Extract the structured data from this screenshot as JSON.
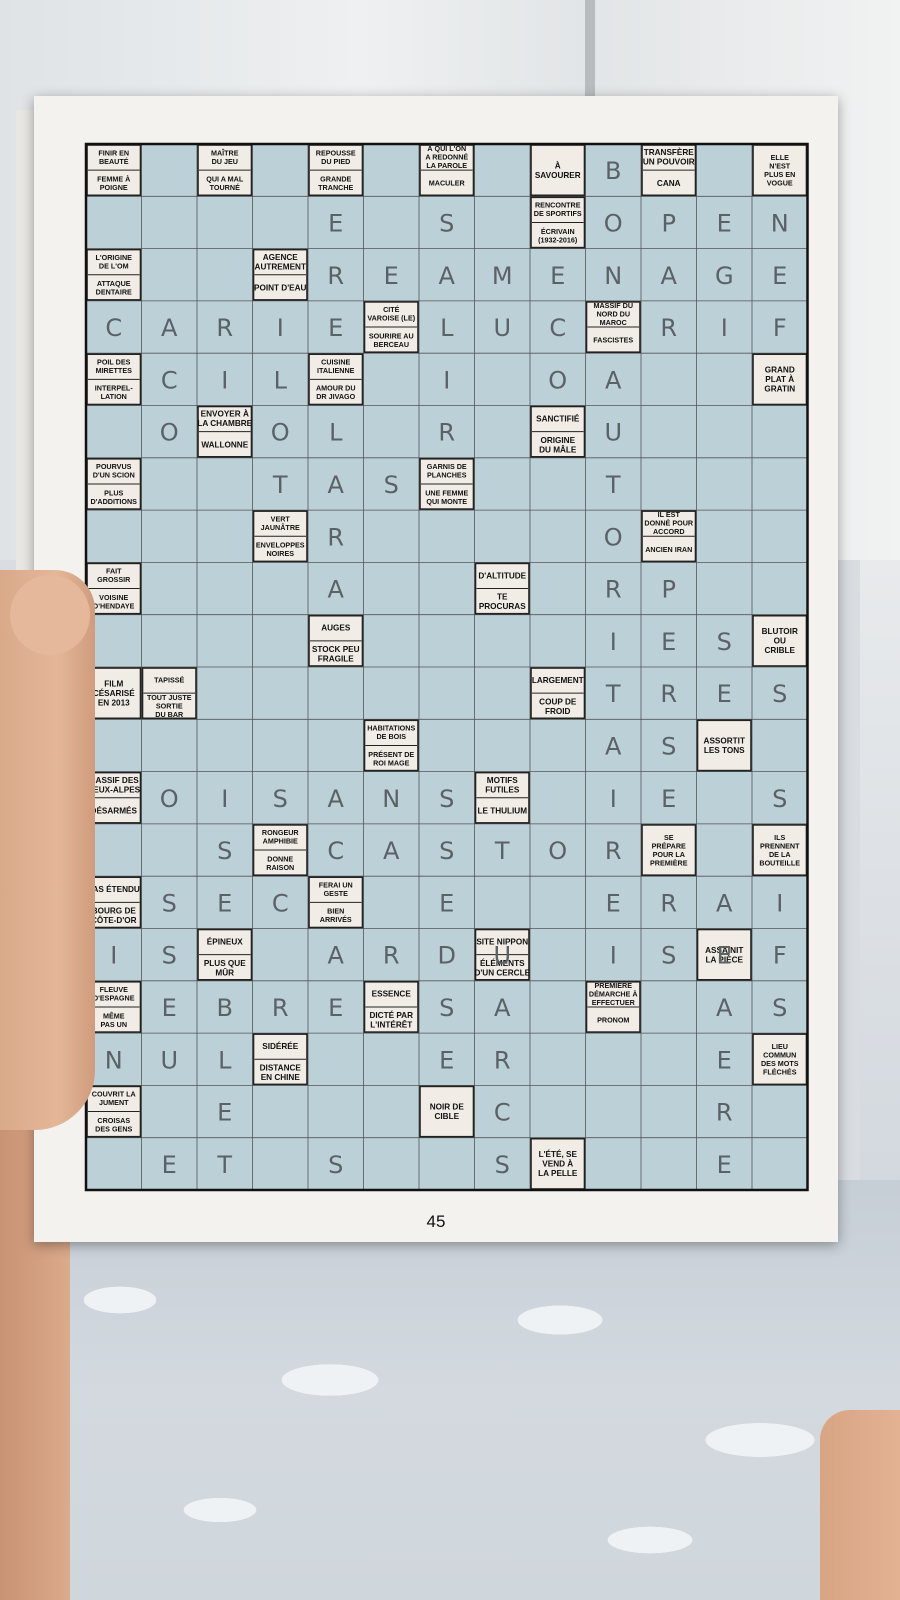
{
  "page_number": "45",
  "colors": {
    "cell": "#bcd0d8",
    "clue": "#f1ede6",
    "ink": "#111111",
    "pencil": "#5c6166"
  },
  "clues": [
    {
      "c": 0,
      "r": 0,
      "lines": [
        [
          "FINIR EN",
          "BEAUTÉ"
        ],
        [
          "FEMME À",
          "POIGNE"
        ]
      ]
    },
    {
      "c": 2,
      "r": 0,
      "lines": [
        [
          "MAÎTRE",
          "DU JEU"
        ],
        [
          "QUI A MAL",
          "TOURNÉ"
        ]
      ]
    },
    {
      "c": 4,
      "r": 0,
      "lines": [
        [
          "REPOUSSE",
          "DU PIED"
        ],
        [
          "GRANDE",
          "TRANCHE"
        ]
      ]
    },
    {
      "c": 6,
      "r": 0,
      "lines": [
        [
          "À QUI L'ON",
          "A REDONNÉ",
          "LA PAROLE"
        ],
        [
          "MACULER"
        ]
      ]
    },
    {
      "c": 8,
      "r": 0,
      "lines": [
        [
          "À",
          "SAVOURER"
        ]
      ]
    },
    {
      "c": 10,
      "r": 0,
      "lines": [
        [
          "TRANSFÈRE",
          "UN POUVOIR"
        ],
        [
          "CANA"
        ]
      ]
    },
    {
      "c": 12,
      "r": 0,
      "lines": [
        [
          "ELLE",
          "N'EST",
          "PLUS EN",
          "VOGUE"
        ]
      ]
    },
    {
      "c": 8,
      "r": 1,
      "lines": [
        [
          "RENCONTRE",
          "DE SPORTIFS"
        ],
        [
          "ÉCRIVAIN",
          "(1932-2016)"
        ]
      ]
    },
    {
      "c": 0,
      "r": 2,
      "lines": [
        [
          "L'ORIGINE",
          "DE L'OM"
        ],
        [
          "ATTAQUE",
          "DENTAIRE"
        ]
      ]
    },
    {
      "c": 3,
      "r": 2,
      "lines": [
        [
          "AGENCE",
          "AUTREMENT"
        ],
        [
          "POINT D'EAU"
        ]
      ]
    },
    {
      "c": 5,
      "r": 3,
      "lines": [
        [
          "CITÉ",
          "VAROISE (LE)"
        ],
        [
          "SOURIRE AU",
          "BERCEAU"
        ]
      ]
    },
    {
      "c": 9,
      "r": 3,
      "lines": [
        [
          "MASSIF DU",
          "NORD DU",
          "MAROC"
        ],
        [
          "FASCISTES"
        ]
      ]
    },
    {
      "c": 0,
      "r": 4,
      "lines": [
        [
          "POIL DES",
          "MIRETTES"
        ],
        [
          "INTERPEL-",
          "LATION"
        ]
      ]
    },
    {
      "c": 4,
      "r": 4,
      "lines": [
        [
          "CUISINE",
          "ITALIENNE"
        ],
        [
          "AMOUR DU",
          "DR JIVAGO"
        ]
      ]
    },
    {
      "c": 12,
      "r": 4,
      "lines": [
        [
          "GRAND",
          "PLAT À",
          "GRATIN"
        ]
      ]
    },
    {
      "c": 2,
      "r": 5,
      "lines": [
        [
          "ENVOYER À",
          "LA CHAMBRE"
        ],
        [
          "WALLONNE"
        ]
      ]
    },
    {
      "c": 8,
      "r": 5,
      "lines": [
        [
          "SANCTIFIÉ"
        ],
        [
          "ORIGINE",
          "DU MÂLE"
        ]
      ]
    },
    {
      "c": 0,
      "r": 6,
      "lines": [
        [
          "POURVUS",
          "D'UN SCION"
        ],
        [
          "PLUS",
          "D'ADDITIONS"
        ]
      ]
    },
    {
      "c": 6,
      "r": 6,
      "lines": [
        [
          "GARNIS DE",
          "PLANCHES"
        ],
        [
          "UNE FEMME",
          "QUI MONTE"
        ]
      ]
    },
    {
      "c": 3,
      "r": 7,
      "lines": [
        [
          "VERT",
          "JAUNÂTRE"
        ],
        [
          "ENVELOPPES",
          "NOIRES"
        ]
      ]
    },
    {
      "c": 10,
      "r": 7,
      "lines": [
        [
          "IL EST",
          "DONNÉ POUR",
          "ACCORD"
        ],
        [
          "ANCIEN IRAN"
        ]
      ]
    },
    {
      "c": 0,
      "r": 8,
      "lines": [
        [
          "FAIT",
          "GROSSIR"
        ],
        [
          "VOISINE",
          "D'HENDAYE"
        ]
      ]
    },
    {
      "c": 7,
      "r": 8,
      "lines": [
        [
          "D'ALTITUDE"
        ],
        [
          "TE",
          "PROCURAS"
        ]
      ]
    },
    {
      "c": 4,
      "r": 9,
      "lines": [
        [
          "AUGES"
        ],
        [
          "STOCK PEU",
          "FRAGILE"
        ]
      ]
    },
    {
      "c": 12,
      "r": 9,
      "lines": [
        [
          "BLUTOIR",
          "OU",
          "CRIBLE"
        ]
      ]
    },
    {
      "c": 0,
      "r": 10,
      "lines": [
        [
          "FILM",
          "CÉSARISÉ",
          "EN 2013"
        ]
      ]
    },
    {
      "c": 1,
      "r": 10,
      "lines": [
        [
          "TAPISSÉ"
        ],
        [
          "TOUT JUSTE",
          "SORTIE",
          "DU BAR"
        ]
      ]
    },
    {
      "c": 8,
      "r": 10,
      "lines": [
        [
          "LARGEMENT"
        ],
        [
          "COUP DE",
          "FROID"
        ]
      ]
    },
    {
      "c": 5,
      "r": 11,
      "lines": [
        [
          "HABITATIONS",
          "DE BOIS"
        ],
        [
          "PRÉSENT DE",
          "ROI MAGE"
        ]
      ]
    },
    {
      "c": 11,
      "r": 11,
      "lines": [
        [
          "ASSORTIT",
          "LES TONS"
        ]
      ]
    },
    {
      "c": 0,
      "r": 12,
      "lines": [
        [
          "MASSIF DES",
          "DEUX-ALPES"
        ],
        [
          "DÉSARMÉS"
        ]
      ]
    },
    {
      "c": 7,
      "r": 12,
      "lines": [
        [
          "MOTIFS",
          "FUTILES"
        ],
        [
          "LE THULIUM"
        ]
      ]
    },
    {
      "c": 3,
      "r": 13,
      "lines": [
        [
          "RONGEUR",
          "AMPHIBIE"
        ],
        [
          "DONNE",
          "RAISON"
        ]
      ]
    },
    {
      "c": 10,
      "r": 13,
      "lines": [
        [
          "SE",
          "PRÉPARE",
          "POUR LA",
          "PREMIÈRE"
        ]
      ]
    },
    {
      "c": 12,
      "r": 13,
      "lines": [
        [
          "ILS",
          "PRENNENT",
          "DE LA",
          "BOUTEILLE"
        ]
      ]
    },
    {
      "c": 0,
      "r": 14,
      "lines": [
        [
          "PAS ÉTENDU"
        ],
        [
          "BOURG DE",
          "CÔTE-D'OR"
        ]
      ]
    },
    {
      "c": 4,
      "r": 14,
      "lines": [
        [
          "FERAI UN",
          "GESTE"
        ],
        [
          "BIEN",
          "ARRIVÉS"
        ]
      ]
    },
    {
      "c": 2,
      "r": 15,
      "lines": [
        [
          "ÉPINEUX"
        ],
        [
          "PLUS QUE",
          "MÛR"
        ]
      ]
    },
    {
      "c": 7,
      "r": 15,
      "lines": [
        [
          "SITE NIPPON"
        ],
        [
          "ÉLÉMENTS",
          "D'UN CERCLE"
        ]
      ]
    },
    {
      "c": 11,
      "r": 15,
      "lines": [
        [
          "ASSAINIT",
          "LA PIÈCE"
        ]
      ]
    },
    {
      "c": 0,
      "r": 16,
      "lines": [
        [
          "FLEUVE",
          "D'ESPAGNE"
        ],
        [
          "MÊME",
          "PAS UN"
        ]
      ]
    },
    {
      "c": 5,
      "r": 16,
      "lines": [
        [
          "ESSENCE"
        ],
        [
          "DICTÉ PAR",
          "L'INTÉRÊT"
        ]
      ]
    },
    {
      "c": 9,
      "r": 16,
      "lines": [
        [
          "PREMIÈRE",
          "DÉMARCHE À",
          "EFFECTUER"
        ],
        [
          "PRONOM"
        ]
      ]
    },
    {
      "c": 3,
      "r": 17,
      "lines": [
        [
          "SIDÉRÉE"
        ],
        [
          "DISTANCE",
          "EN CHINE"
        ]
      ]
    },
    {
      "c": 12,
      "r": 17,
      "lines": [
        [
          "LIEU",
          "COMMUN",
          "DES MOTS",
          "FLÉCHÉS"
        ]
      ]
    },
    {
      "c": 0,
      "r": 18,
      "lines": [
        [
          "COUVRIT LA",
          "JUMENT"
        ],
        [
          "CROISAS",
          "DES GENS"
        ]
      ]
    },
    {
      "c": 6,
      "r": 18,
      "lines": [
        [
          "NOIR DE",
          "CIBLE"
        ]
      ]
    },
    {
      "c": 8,
      "r": 19,
      "lines": [
        [
          "L'ÉTÉ, SE",
          "VEND À",
          "LA PELLE"
        ]
      ]
    }
  ],
  "letters": [
    {
      "c": 9,
      "r": 0,
      "t": "B"
    },
    {
      "c": 4,
      "r": 1,
      "t": "E"
    },
    {
      "c": 6,
      "r": 1,
      "t": "S"
    },
    {
      "c": 9,
      "r": 1,
      "t": "O"
    },
    {
      "c": 10,
      "r": 1,
      "t": "P"
    },
    {
      "c": 11,
      "r": 1,
      "t": "E"
    },
    {
      "c": 12,
      "r": 1,
      "t": "N"
    },
    {
      "c": 4,
      "r": 2,
      "t": "R"
    },
    {
      "c": 5,
      "r": 2,
      "t": "E"
    },
    {
      "c": 6,
      "r": 2,
      "t": "A"
    },
    {
      "c": 7,
      "r": 2,
      "t": "M"
    },
    {
      "c": 8,
      "r": 2,
      "t": "E"
    },
    {
      "c": 9,
      "r": 2,
      "t": "N"
    },
    {
      "c": 10,
      "r": 2,
      "t": "A"
    },
    {
      "c": 11,
      "r": 2,
      "t": "G"
    },
    {
      "c": 12,
      "r": 2,
      "t": "E"
    },
    {
      "c": 0,
      "r": 3,
      "t": "C"
    },
    {
      "c": 1,
      "r": 3,
      "t": "A"
    },
    {
      "c": 2,
      "r": 3,
      "t": "R"
    },
    {
      "c": 3,
      "r": 3,
      "t": "I"
    },
    {
      "c": 4,
      "r": 3,
      "t": "E"
    },
    {
      "c": 6,
      "r": 3,
      "t": "L"
    },
    {
      "c": 7,
      "r": 3,
      "t": "U"
    },
    {
      "c": 8,
      "r": 3,
      "t": "C"
    },
    {
      "c": 10,
      "r": 3,
      "t": "R"
    },
    {
      "c": 11,
      "r": 3,
      "t": "I"
    },
    {
      "c": 12,
      "r": 3,
      "t": "F"
    },
    {
      "c": 1,
      "r": 4,
      "t": "C"
    },
    {
      "c": 2,
      "r": 4,
      "t": "I"
    },
    {
      "c": 3,
      "r": 4,
      "t": "L"
    },
    {
      "c": 6,
      "r": 4,
      "t": "I"
    },
    {
      "c": 8,
      "r": 4,
      "t": "O"
    },
    {
      "c": 9,
      "r": 4,
      "t": "A"
    },
    {
      "c": 1,
      "r": 5,
      "t": "O"
    },
    {
      "c": 3,
      "r": 5,
      "t": "O"
    },
    {
      "c": 4,
      "r": 5,
      "t": "L"
    },
    {
      "c": 6,
      "r": 5,
      "t": "R"
    },
    {
      "c": 9,
      "r": 5,
      "t": "U"
    },
    {
      "c": 3,
      "r": 6,
      "t": "T"
    },
    {
      "c": 4,
      "r": 6,
      "t": "A"
    },
    {
      "c": 5,
      "r": 6,
      "t": "S"
    },
    {
      "c": 9,
      "r": 6,
      "t": "T"
    },
    {
      "c": 4,
      "r": 7,
      "t": "R"
    },
    {
      "c": 9,
      "r": 7,
      "t": "O"
    },
    {
      "c": 4,
      "r": 8,
      "t": "A"
    },
    {
      "c": 9,
      "r": 8,
      "t": "R"
    },
    {
      "c": 10,
      "r": 8,
      "t": "P"
    },
    {
      "c": 9,
      "r": 9,
      "t": "I"
    },
    {
      "c": 10,
      "r": 9,
      "t": "E"
    },
    {
      "c": 11,
      "r": 9,
      "t": "S"
    },
    {
      "c": 9,
      "r": 10,
      "t": "T"
    },
    {
      "c": 10,
      "r": 10,
      "t": "R"
    },
    {
      "c": 11,
      "r": 10,
      "t": "E"
    },
    {
      "c": 12,
      "r": 10,
      "t": "S"
    },
    {
      "c": 9,
      "r": 11,
      "t": "A"
    },
    {
      "c": 10,
      "r": 11,
      "t": "S"
    },
    {
      "c": 1,
      "r": 12,
      "t": "O"
    },
    {
      "c": 2,
      "r": 12,
      "t": "I"
    },
    {
      "c": 3,
      "r": 12,
      "t": "S"
    },
    {
      "c": 4,
      "r": 12,
      "t": "A"
    },
    {
      "c": 5,
      "r": 12,
      "t": "N"
    },
    {
      "c": 6,
      "r": 12,
      "t": "S"
    },
    {
      "c": 9,
      "r": 12,
      "t": "I"
    },
    {
      "c": 10,
      "r": 12,
      "t": "E"
    },
    {
      "c": 12,
      "r": 12,
      "t": "S"
    },
    {
      "c": 2,
      "r": 13,
      "t": "S"
    },
    {
      "c": 4,
      "r": 13,
      "t": "C"
    },
    {
      "c": 5,
      "r": 13,
      "t": "A"
    },
    {
      "c": 6,
      "r": 13,
      "t": "S"
    },
    {
      "c": 7,
      "r": 13,
      "t": "T"
    },
    {
      "c": 8,
      "r": 13,
      "t": "O"
    },
    {
      "c": 9,
      "r": 13,
      "t": "R"
    },
    {
      "c": 1,
      "r": 14,
      "t": "S"
    },
    {
      "c": 2,
      "r": 14,
      "t": "E"
    },
    {
      "c": 3,
      "r": 14,
      "t": "C"
    },
    {
      "c": 6,
      "r": 14,
      "t": "E"
    },
    {
      "c": 9,
      "r": 14,
      "t": "E"
    },
    {
      "c": 10,
      "r": 14,
      "t": "R"
    },
    {
      "c": 11,
      "r": 14,
      "t": "A"
    },
    {
      "c": 12,
      "r": 14,
      "t": "I"
    },
    {
      "c": 0,
      "r": 15,
      "t": "I"
    },
    {
      "c": 1,
      "r": 15,
      "t": "S"
    },
    {
      "c": 4,
      "r": 15,
      "t": "A"
    },
    {
      "c": 5,
      "r": 15,
      "t": "R"
    },
    {
      "c": 6,
      "r": 15,
      "t": "D"
    },
    {
      "c": 7,
      "r": 15,
      "t": "U"
    },
    {
      "c": 9,
      "r": 15,
      "t": "I"
    },
    {
      "c": 10,
      "r": 15,
      "t": "S"
    },
    {
      "c": 11,
      "r": 15,
      "t": "E"
    },
    {
      "c": 12,
      "r": 15,
      "t": "F"
    },
    {
      "c": 1,
      "r": 16,
      "t": "E"
    },
    {
      "c": 2,
      "r": 16,
      "t": "B"
    },
    {
      "c": 3,
      "r": 16,
      "t": "R"
    },
    {
      "c": 4,
      "r": 16,
      "t": "E"
    },
    {
      "c": 6,
      "r": 16,
      "t": "S"
    },
    {
      "c": 7,
      "r": 16,
      "t": "A"
    },
    {
      "c": 11,
      "r": 16,
      "t": "A"
    },
    {
      "c": 12,
      "r": 16,
      "t": "S"
    },
    {
      "c": 0,
      "r": 17,
      "t": "N"
    },
    {
      "c": 1,
      "r": 17,
      "t": "U"
    },
    {
      "c": 2,
      "r": 17,
      "t": "L"
    },
    {
      "c": 6,
      "r": 17,
      "t": "E"
    },
    {
      "c": 7,
      "r": 17,
      "t": "R"
    },
    {
      "c": 11,
      "r": 17,
      "t": "E"
    },
    {
      "c": 2,
      "r": 18,
      "t": "E"
    },
    {
      "c": 7,
      "r": 18,
      "t": "C"
    },
    {
      "c": 11,
      "r": 18,
      "t": "R"
    },
    {
      "c": 1,
      "r": 19,
      "t": "E"
    },
    {
      "c": 2,
      "r": 19,
      "t": "T"
    },
    {
      "c": 4,
      "r": 19,
      "t": "S"
    },
    {
      "c": 7,
      "r": 19,
      "t": "S"
    },
    {
      "c": 11,
      "r": 19,
      "t": "E"
    }
  ]
}
